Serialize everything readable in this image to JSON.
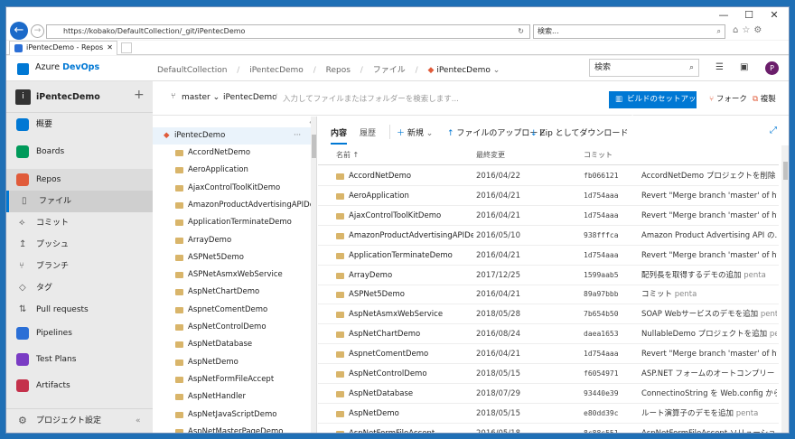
{
  "browser": {
    "url": "https://kobako/DefaultCollection/_git/iPentecDemo",
    "search_placeholder": "検索...",
    "tab_title": "iPentecDemo - Repos"
  },
  "header": {
    "brand_prefix": "Azure ",
    "brand": "DevOps",
    "breadcrumb": [
      "DefaultCollection",
      "iPentecDemo",
      "Repos",
      "ファイル",
      "iPentecDemo"
    ],
    "search_placeholder": "検索",
    "avatar": "P"
  },
  "sidebar": {
    "project": "iPentecDemo",
    "project_initial": "i",
    "items": [
      {
        "label": "概要",
        "color": "#0078d4"
      },
      {
        "label": "Boards",
        "color": "#009a5a"
      },
      {
        "label": "Repos",
        "color": "#e05b3a"
      }
    ],
    "sub": [
      {
        "label": "ファイル",
        "icon": "▯"
      },
      {
        "label": "コミット",
        "icon": "⟡"
      },
      {
        "label": "プッシュ",
        "icon": "↥"
      },
      {
        "label": "ブランチ",
        "icon": "⑂"
      },
      {
        "label": "タグ",
        "icon": "◇"
      },
      {
        "label": "Pull requests",
        "icon": "⇅"
      }
    ],
    "items2": [
      {
        "label": "Pipelines",
        "color": "#2b6fd6"
      },
      {
        "label": "Test Plans",
        "color": "#7a3cc4"
      },
      {
        "label": "Artifacts",
        "color": "#c4314b"
      }
    ],
    "settings": "プロジェクト設定"
  },
  "repo_bar": {
    "branch": "master",
    "repo": "iPentecDemo",
    "path_placeholder": "入力してファイルまたはフォルダーを検索します...",
    "build_button": "ビルドのセットアップ",
    "fork": "フォーク",
    "clone": "複製"
  },
  "tree": {
    "root": "iPentecDemo",
    "folders": [
      "AccordNetDemo",
      "AeroApplication",
      "AjaxControlToolKitDemo",
      "AmazonProductAdvertisingAPIDe...",
      "ApplicationTerminateDemo",
      "ArrayDemo",
      "ASPNet5Demo",
      "ASPNetAsmxWebService",
      "AspNetChartDemo",
      "AspnetComentDemo",
      "AspNetControlDemo",
      "AspNetDatabase",
      "AspNetDemo",
      "AspNetFormFileAccept",
      "AspNetHandler",
      "AspNetJavaScriptDemo",
      "AspNetMasterPageDemo"
    ]
  },
  "content": {
    "tabs": [
      "内容",
      "履歴"
    ],
    "new": "新規",
    "upload": "ファイルのアップロード",
    "download": "Zip としてダウンロード",
    "columns": [
      "名前 ↑",
      "最終変更",
      "コミット"
    ],
    "rows": [
      {
        "name": "AccordNetDemo",
        "date": "2016/04/22",
        "commit": "fb066121",
        "msg": "AccordNetDemo プロジェクトを削除",
        "author": "pe"
      },
      {
        "name": "AeroApplication",
        "date": "2016/04/21",
        "commit": "1d754aaa",
        "msg": "Revert \"Merge branch 'master' of htt...",
        "author": ""
      },
      {
        "name": "AjaxControlToolKitDemo",
        "date": "2016/04/21",
        "commit": "1d754aaa",
        "msg": "Revert \"Merge branch 'master' of htt...",
        "author": ""
      },
      {
        "name": "AmazonProductAdvertisingAPIDe...",
        "date": "2016/05/10",
        "commit": "938fffca",
        "msg": "Amazon Product Advertising API の...",
        "author": ""
      },
      {
        "name": "ApplicationTerminateDemo",
        "date": "2016/04/21",
        "commit": "1d754aaa",
        "msg": "Revert \"Merge branch 'master' of htt...",
        "author": ""
      },
      {
        "name": "ArrayDemo",
        "date": "2017/12/25",
        "commit": "1599aab5",
        "msg": "配列長を取得するデモの追加",
        "author": "penta"
      },
      {
        "name": "ASPNet5Demo",
        "date": "2016/04/21",
        "commit": "89a97bbb",
        "msg": "コミット",
        "author": "penta"
      },
      {
        "name": "AspNetAsmxWebService",
        "date": "2018/05/28",
        "commit": "7b654b50",
        "msg": "SOAP Webサービスのデモを追加",
        "author": "penta"
      },
      {
        "name": "AspNetChartDemo",
        "date": "2016/08/24",
        "commit": "daea1653",
        "msg": "NullableDemo プロジェクトを追加",
        "author": "penta"
      },
      {
        "name": "AspnetComentDemo",
        "date": "2016/04/21",
        "commit": "1d754aaa",
        "msg": "Revert \"Merge branch 'master' of htt...",
        "author": ""
      },
      {
        "name": "AspNetControlDemo",
        "date": "2018/05/15",
        "commit": "f6054971",
        "msg": "ASP.NET フォームのオートコンプリートを無...",
        "author": ""
      },
      {
        "name": "AspNetDatabase",
        "date": "2018/07/29",
        "commit": "93440e39",
        "msg": "ConnectinoString を Web.config から...",
        "author": ""
      },
      {
        "name": "AspNetDemo",
        "date": "2018/05/15",
        "commit": "e80dd39c",
        "msg": "ルート演算子のデモを追加",
        "author": "penta"
      },
      {
        "name": "AspNetFormFileAccept",
        "date": "2016/05/18",
        "commit": "8c88c551",
        "msg": "AspNetFormFileAccept ソリューションの",
        "author": ""
      }
    ]
  }
}
